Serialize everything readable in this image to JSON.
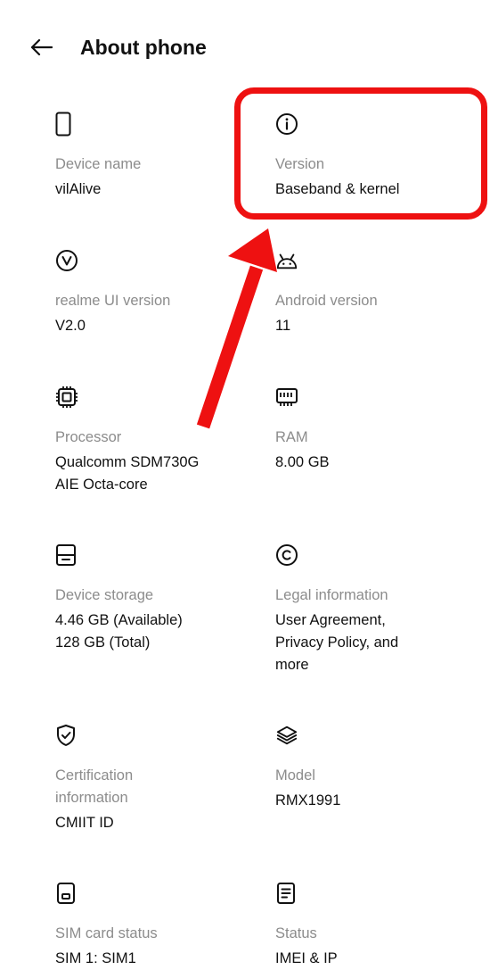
{
  "header": {
    "title": "About phone",
    "back_icon": "arrow-left-icon"
  },
  "items": [
    {
      "icon": "phone-outline-icon",
      "label": "Device name",
      "value": "vilAlive"
    },
    {
      "icon": "info-circle-icon",
      "label": "Version",
      "value": "Baseband & kernel"
    },
    {
      "icon": "realme-v-circle-icon",
      "label": "realme UI version",
      "value": "V2.0"
    },
    {
      "icon": "android-robot-icon",
      "label": "Android version",
      "value": "11"
    },
    {
      "icon": "processor-chip-icon",
      "label": "Processor",
      "value": "Qualcomm SDM730G\nAIE Octa-core"
    },
    {
      "icon": "memory-ram-icon",
      "label": "RAM",
      "value": "8.00 GB"
    },
    {
      "icon": "storage-icon",
      "label": "Device storage",
      "value": "4.46 GB (Available)\n128 GB (Total)"
    },
    {
      "icon": "copyright-circle-icon",
      "label": "Legal information",
      "value": "User Agreement,\nPrivacy Policy, and\nmore"
    },
    {
      "icon": "shield-check-icon",
      "label": "Certification\ninformation",
      "value": "CMIIT ID"
    },
    {
      "icon": "layers-icon",
      "label": "Model",
      "value": "RMX1991"
    },
    {
      "icon": "sim-card-icon",
      "label": "SIM card status",
      "value": "SIM 1: SIM1"
    },
    {
      "icon": "status-document-icon",
      "label": "Status",
      "value": "IMEI & IP"
    }
  ],
  "annotation": {
    "highlight_color": "#ee1111",
    "highlighted_item": "Version"
  }
}
